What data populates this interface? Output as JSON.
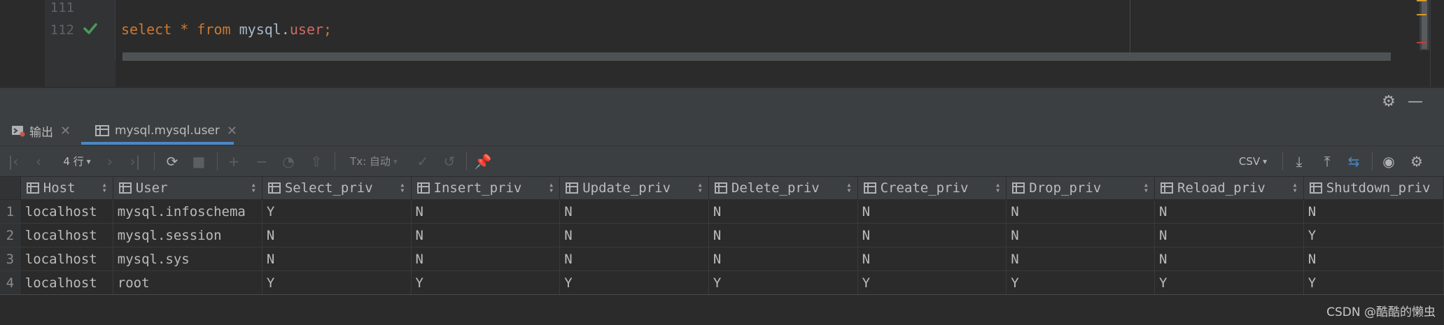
{
  "editor": {
    "line_numbers": [
      "111",
      "112"
    ],
    "code": {
      "kw1": "select",
      "star": "*",
      "kw2": "from",
      "schema": "mysql.",
      "table": "user",
      "semi": ";"
    }
  },
  "tabs": [
    {
      "label": "输出",
      "icon": "console-output-icon"
    },
    {
      "label": "mysql.mysql.user",
      "icon": "table-icon"
    }
  ],
  "toolbar": {
    "row_count": "4 行",
    "tx_mode": "Tx: 自动",
    "export_format": "CSV"
  },
  "grid": {
    "columns": [
      "Host",
      "User",
      "Select_priv",
      "Insert_priv",
      "Update_priv",
      "Delete_priv",
      "Create_priv",
      "Drop_priv",
      "Reload_priv",
      "Shutdown_priv"
    ],
    "rows": [
      {
        "num": "1",
        "cells": [
          "localhost",
          "mysql.infoschema",
          "Y",
          "N",
          "N",
          "N",
          "N",
          "N",
          "N",
          "N"
        ]
      },
      {
        "num": "2",
        "cells": [
          "localhost",
          "mysql.session",
          "N",
          "N",
          "N",
          "N",
          "N",
          "N",
          "N",
          "Y"
        ]
      },
      {
        "num": "3",
        "cells": [
          "localhost",
          "mysql.sys",
          "N",
          "N",
          "N",
          "N",
          "N",
          "N",
          "N",
          "N"
        ]
      },
      {
        "num": "4",
        "cells": [
          "localhost",
          "root",
          "Y",
          "Y",
          "Y",
          "Y",
          "Y",
          "Y",
          "Y",
          "Y"
        ]
      }
    ]
  },
  "watermark": "CSDN @酷酷的懒虫",
  "colors": {
    "keyword": "#cc7832",
    "table_name": "#cf6a62",
    "check": "#499c54",
    "accent": "#4a88c7"
  }
}
